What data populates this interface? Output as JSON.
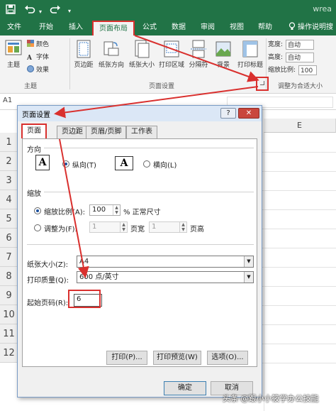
{
  "window": {
    "title": "wrea",
    "quick_access_save_icon": "save-icon",
    "quick_access_undo_icon": "undo-icon"
  },
  "tabs": [
    {
      "label": "文件"
    },
    {
      "label": "开始"
    },
    {
      "label": "插入"
    },
    {
      "label": "页面布局",
      "active": true
    },
    {
      "label": "公式"
    },
    {
      "label": "数据"
    },
    {
      "label": "审阅"
    },
    {
      "label": "视图"
    },
    {
      "label": "帮助"
    }
  ],
  "tell_me": "操作说明搜",
  "ribbon": {
    "themes": {
      "theme_label": "主题",
      "colors_label": "颜色",
      "fonts_label": "字体",
      "effects_label": "效果",
      "group_label": "主题"
    },
    "page_setup": {
      "margins": "页边距",
      "orientation": "纸张方向",
      "size": "纸张大小",
      "print_area": "打印区域",
      "breaks": "分隔符",
      "background": "背景",
      "print_titles": "打印标题",
      "group_label": "页面设置"
    },
    "scale": {
      "width_label": "宽度:",
      "width_value": "自动",
      "height_label": "高度:",
      "height_value": "自动",
      "scale_label": "缩放比例:",
      "scale_value": "100",
      "group_label": "调整为合适大小"
    }
  },
  "formula_bar": {
    "name_box": "A1"
  },
  "grid": {
    "rows": [
      "1",
      "2",
      "3",
      "4",
      "5",
      "6",
      "7",
      "8",
      "9",
      "10",
      "11",
      "12"
    ],
    "col_e": "E"
  },
  "dialog": {
    "title": "页面设置",
    "help_btn": "?",
    "close_btn": "✕",
    "tabs": [
      {
        "label": "页面",
        "active": true
      },
      {
        "label": "页边距"
      },
      {
        "label": "页眉/页脚"
      },
      {
        "label": "工作表"
      }
    ],
    "orientation": {
      "section": "方向",
      "portrait": "纵向(T)",
      "landscape": "横向(L)",
      "icon_letter": "A",
      "selected": "portrait"
    },
    "scaling": {
      "section": "缩放",
      "adjust_label": "缩放比例(A):",
      "adjust_value": "100",
      "adjust_unit": "% 正常尺寸",
      "fit_label": "调整为(F):",
      "fit_wide": "1",
      "fit_wide_unit": "页宽",
      "fit_tall": "1",
      "fit_tall_unit": "页高",
      "selected": "adjust"
    },
    "paper_size": {
      "label": "纸张大小(Z):",
      "value": "A4"
    },
    "print_quality": {
      "label": "打印质量(Q):",
      "value": "600 点/英寸"
    },
    "first_page": {
      "label": "起始页码(R):",
      "value": "6"
    },
    "buttons": {
      "print": "打印(P)...",
      "preview": "打印预览(W)",
      "options": "选项(O)...",
      "ok": "确定",
      "cancel": "取消"
    }
  },
  "watermark": "头条 @跟小小筱学办公技能",
  "colors": {
    "excel_green": "#217346",
    "annotation_red": "#d9302e"
  }
}
